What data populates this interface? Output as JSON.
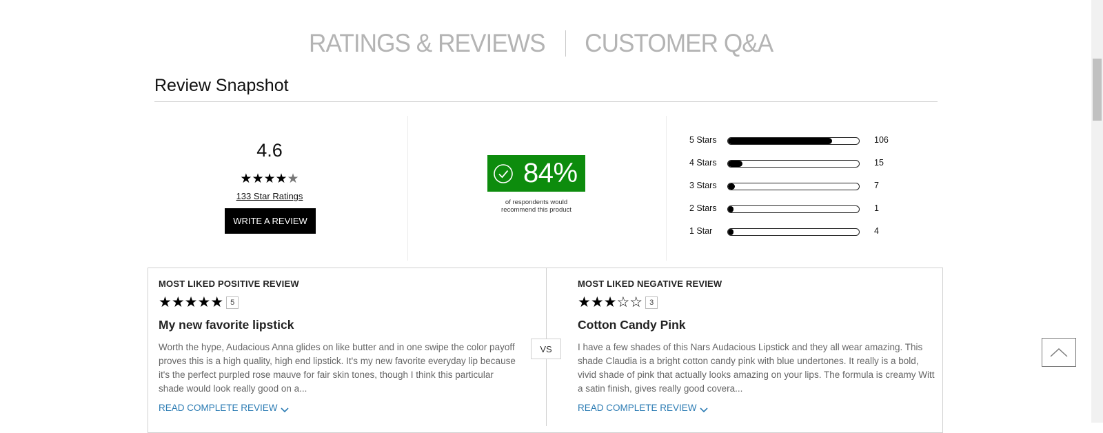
{
  "tabs": {
    "ratings": "RATINGS & REVIEWS",
    "qa": "CUSTOMER Q&A"
  },
  "snapshot": {
    "title": "Review Snapshot",
    "average": "4.6",
    "stars_full": "★★★★",
    "star_partial": "★",
    "rating_count_link": "133 Star Ratings",
    "write_review": "WRITE A REVIEW",
    "recommend_percent": "84%",
    "recommend_caption_1": "of respondents would",
    "recommend_caption_2": "recommend this product",
    "recommend_color": "#0d8c0d",
    "histogram": [
      {
        "label": "5 Stars",
        "count": "106",
        "fraction": 0.797
      },
      {
        "label": "4 Stars",
        "count": "15",
        "fraction": 0.113
      },
      {
        "label": "3 Stars",
        "count": "7",
        "fraction": 0.053
      },
      {
        "label": "2 Stars",
        "count": "1",
        "fraction": 0.008
      },
      {
        "label": "1 Star",
        "count": "4",
        "fraction": 0.03
      }
    ]
  },
  "featured": {
    "vs": "VS",
    "positive": {
      "heading": "MOST LIKED POSITIVE REVIEW",
      "stars_filled": "★★★★★",
      "stars_empty": "",
      "rating": "5",
      "title": "My new favorite lipstick",
      "body": "Worth the hype, Audacious Anna glides on like butter and in one swipe the color payoff proves this is a high quality, high end lipstick. It's my new favorite everyday lip because it's the perfect purpled rose mauve for fair skin tones, though I think this particular shade would look really good on a...",
      "read_more": "READ COMPLETE REVIEW"
    },
    "negative": {
      "heading": "MOST LIKED NEGATIVE REVIEW",
      "stars_filled": "★★★",
      "stars_empty": "☆☆",
      "rating": "3",
      "title": "Cotton Candy Pink",
      "body": "I have a few shades of this Nars Audacious Lipstick and they all wear amazing. This shade Claudia is a bright cotton candy pink with blue undertones. It really is a bold, vivid shade of pink that actually looks amazing on your lips. The formula is creamy Witt a satin finish, gives really good covera...",
      "read_more": "READ COMPLETE REVIEW"
    },
    "link_color": "#2b7bb3"
  }
}
